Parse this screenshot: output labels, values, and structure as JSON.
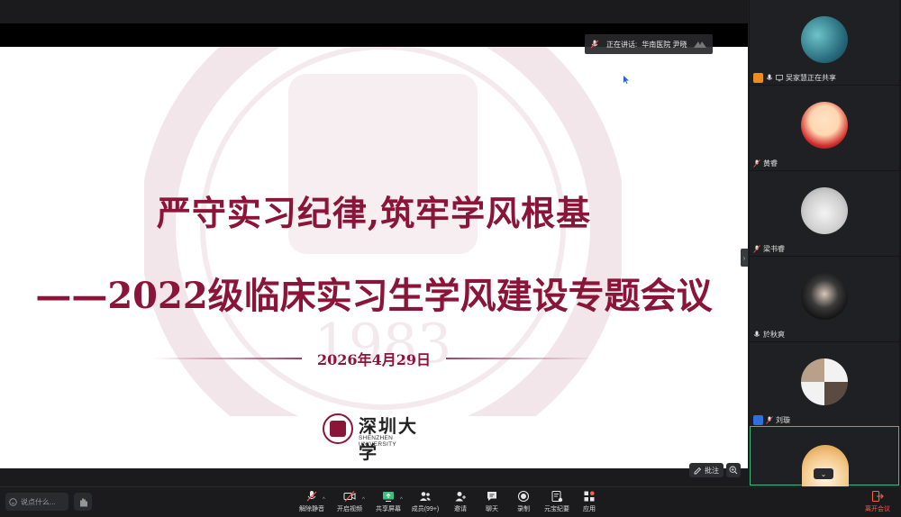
{
  "speaker_bar": {
    "label": "正在讲话:",
    "speaker": "华南医院 尹晓"
  },
  "slide": {
    "title_line1": "严守实习纪律,筑牢学风根基",
    "title_line2": "——2022级临床实习生学风建设专题会议",
    "date": "2026年4月29日",
    "university_name": "深圳大学",
    "university_en": "SHENZHEN UNIVERSITY",
    "accent_color": "#8a1538"
  },
  "overlay_buttons": {
    "annotate_label": "批注"
  },
  "participants": [
    {
      "name": "吴家慧正在共享",
      "sharing": true,
      "muted": false
    },
    {
      "name": "黄睿",
      "sharing": false,
      "muted": true
    },
    {
      "name": "梁书睿",
      "sharing": false,
      "muted": true
    },
    {
      "name": "於秋爽",
      "sharing": false,
      "muted": false
    },
    {
      "name": "刘璇",
      "sharing": false,
      "muted": true,
      "host": true
    },
    {
      "name": "",
      "sharing": false,
      "muted": false,
      "active": true
    }
  ],
  "toolbar": {
    "chat_placeholder": "说点什么...",
    "items": [
      {
        "label": "解除静音",
        "icon": "mic-muted-icon"
      },
      {
        "label": "开启视频",
        "icon": "video-off-icon"
      },
      {
        "label": "共享屏幕",
        "icon": "share-screen-icon"
      },
      {
        "label": "成员(99+)",
        "icon": "members-icon"
      },
      {
        "label": "邀请",
        "icon": "invite-icon"
      },
      {
        "label": "聊天",
        "icon": "chat-icon"
      },
      {
        "label": "录制",
        "icon": "record-icon"
      },
      {
        "label": "元宝纪要",
        "icon": "summary-icon"
      },
      {
        "label": "应用",
        "icon": "apps-icon"
      }
    ],
    "leave_label": "离开会议"
  }
}
